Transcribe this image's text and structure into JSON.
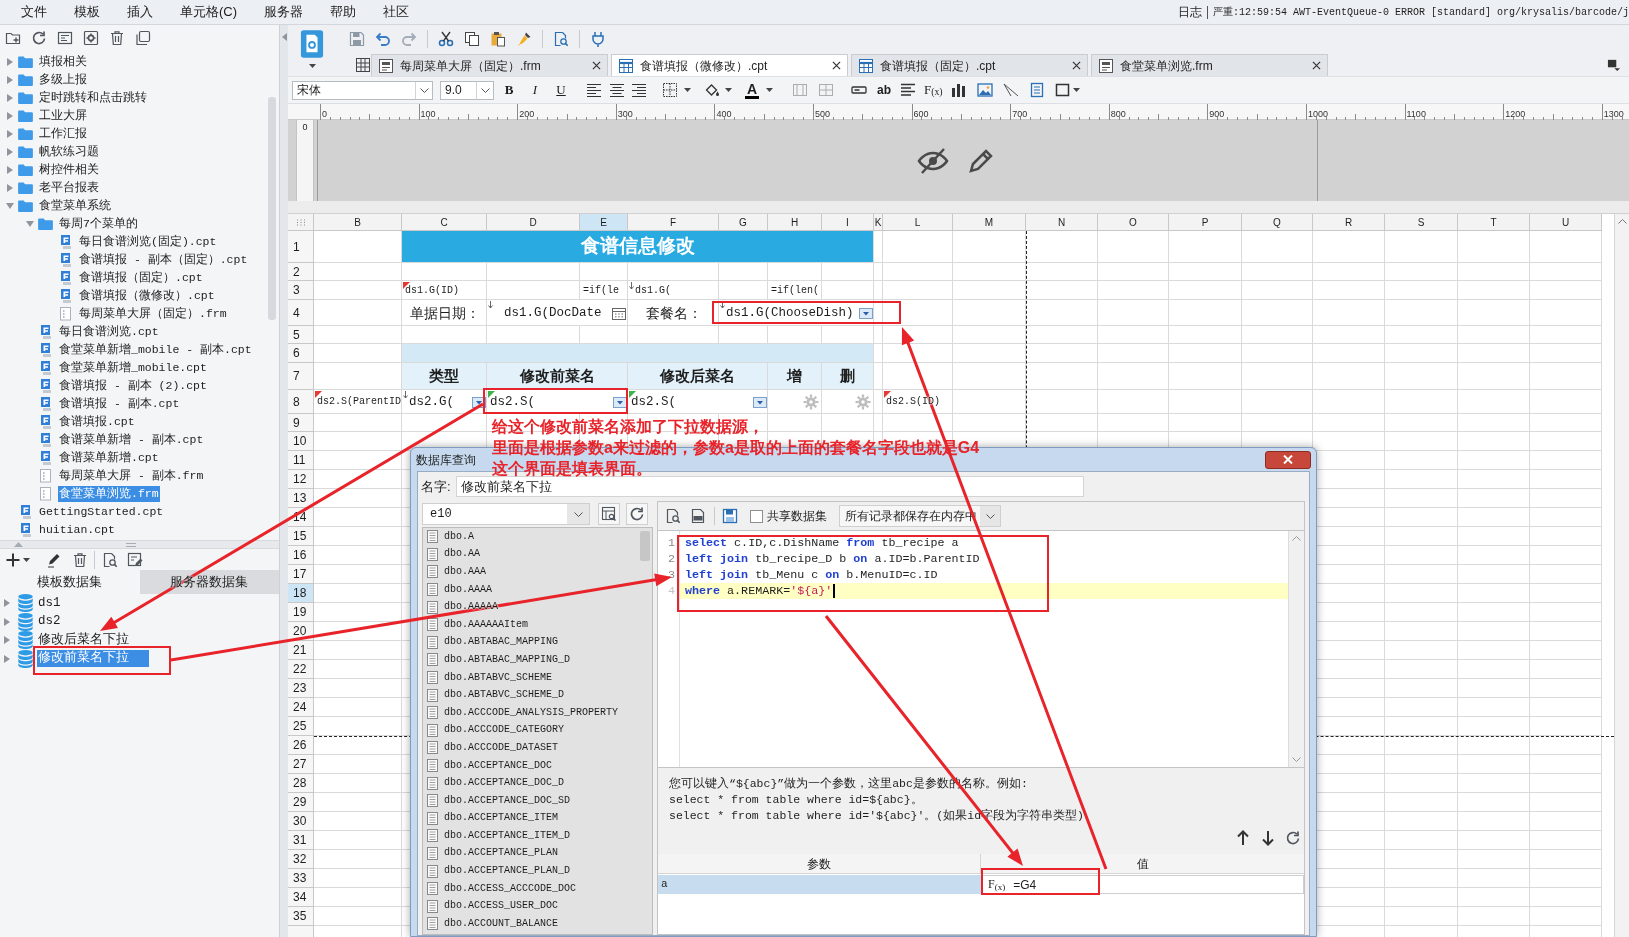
{
  "menu_bar": {
    "items": [
      "文件",
      "模板",
      "插入",
      "单元格(C)",
      "服务器",
      "帮助",
      "社区"
    ],
    "log_label": "日志",
    "log_message": "严重:12:59:54 AWT-EventQueue-0 ERROR [standard] org/krysalis/barcode/j"
  },
  "file_tree": [
    {
      "label": "填报相关",
      "kind": "folder",
      "expanded": false,
      "selected": false
    },
    {
      "label": "多级上报",
      "kind": "folder",
      "expanded": false,
      "selected": false
    },
    {
      "label": "定时跳转和点击跳转",
      "kind": "folder",
      "expanded": false,
      "selected": false
    },
    {
      "label": "工业大屏",
      "kind": "folder",
      "expanded": false,
      "selected": false
    },
    {
      "label": "工作汇报",
      "kind": "folder",
      "expanded": false,
      "selected": false
    },
    {
      "label": "帆软练习题",
      "kind": "folder",
      "expanded": false,
      "selected": false
    },
    {
      "label": "树控件相关",
      "kind": "folder",
      "expanded": false,
      "selected": false
    },
    {
      "label": "老平台报表",
      "kind": "folder",
      "expanded": false,
      "selected": false
    },
    {
      "label": "食堂菜单系统",
      "kind": "folder",
      "expanded": true,
      "selected": false,
      "children": [
        {
          "label": "每周7个菜单的",
          "kind": "folder",
          "expanded": true,
          "selected": false,
          "children": [
            {
              "label": "每日食谱浏览(固定).cpt",
              "kind": "cpt",
              "selected": false
            },
            {
              "label": "食谱填报 - 副本（固定）.cpt",
              "kind": "cpt",
              "selected": false
            },
            {
              "label": "食谱填报（固定）.cpt",
              "kind": "cpt",
              "selected": false
            },
            {
              "label": "食谱填报（微修改）.cpt",
              "kind": "cpt",
              "selected": false
            },
            {
              "label": "每周菜单大屏（固定）.frm",
              "kind": "frm",
              "selected": false
            }
          ]
        },
        {
          "label": "每日食谱浏览.cpt",
          "kind": "cpt",
          "selected": false
        },
        {
          "label": "食堂菜单新增_mobile - 副本.cpt",
          "kind": "cpt",
          "selected": false
        },
        {
          "label": "食堂菜单新增_mobile.cpt",
          "kind": "cpt",
          "selected": false
        },
        {
          "label": "食谱填报 - 副本 (2).cpt",
          "kind": "cpt",
          "selected": false
        },
        {
          "label": "食谱填报 - 副本.cpt",
          "kind": "cpt",
          "selected": false
        },
        {
          "label": "食谱填报.cpt",
          "kind": "cpt",
          "selected": false
        },
        {
          "label": "食谱菜单新增 - 副本.cpt",
          "kind": "cpt",
          "selected": false
        },
        {
          "label": "食谱菜单新增.cpt",
          "kind": "cpt",
          "selected": false
        },
        {
          "label": "每周菜单大屏 - 副本.frm",
          "kind": "frm",
          "selected": false
        },
        {
          "label": "食堂菜单浏览.frm",
          "kind": "frm",
          "selected": true
        }
      ]
    },
    {
      "label": "GettingStarted.cpt",
      "kind": "cpt",
      "selected": false
    },
    {
      "label": "huitian.cpt",
      "kind": "cpt",
      "selected": false
    }
  ],
  "dataset_panel": {
    "tabs": [
      {
        "label": "模板数据集",
        "selected": true
      },
      {
        "label": "服务器数据集",
        "selected": false
      }
    ],
    "datasets": [
      {
        "name": "ds1",
        "expanded": false,
        "selected": false
      },
      {
        "name": "ds2",
        "expanded": false,
        "selected": false
      },
      {
        "name": "修改后菜名下拉",
        "expanded": false,
        "selected": false
      },
      {
        "name": "修改前菜名下拉",
        "expanded": false,
        "selected": true
      }
    ]
  },
  "editor_tabs": [
    {
      "label": "每周菜单大屏（固定）.frm",
      "kind": "frm",
      "selected": false
    },
    {
      "label": "食谱填报（微修改）.cpt",
      "kind": "cpt",
      "selected": true
    },
    {
      "label": "食谱填报（固定）.cpt",
      "kind": "cpt",
      "selected": false
    },
    {
      "label": "食堂菜单浏览.frm",
      "kind": "frm",
      "selected": false
    }
  ],
  "format_toolbar": {
    "font": "宋体",
    "size": "9.0",
    "style_buttons": [
      "B",
      "I",
      "U"
    ],
    "font_color_label": "A",
    "text_tool_label": "ab",
    "formula_tool_label": "F$_{(x)}$"
  },
  "ruler": {
    "labels": [
      "0",
      "100",
      "200",
      "300",
      "400",
      "500",
      "600",
      "700",
      "800",
      "900",
      "1000",
      "1100",
      "1200",
      "1300"
    ],
    "side_label": "0"
  },
  "sheet": {
    "columns": [
      {
        "label": "B",
        "selected": false
      },
      {
        "label": "C",
        "selected": false
      },
      {
        "label": "D",
        "selected": false
      },
      {
        "label": "E",
        "selected": true
      },
      {
        "label": "F",
        "selected": false
      },
      {
        "label": "G",
        "selected": false
      },
      {
        "label": "H",
        "selected": false
      },
      {
        "label": "I",
        "selected": false
      },
      {
        "label": "K",
        "selected": false
      },
      {
        "label": "L",
        "selected": false
      },
      {
        "label": "M",
        "selected": false
      },
      {
        "label": "N",
        "selected": false
      },
      {
        "label": "O",
        "selected": false
      },
      {
        "label": "P",
        "selected": false
      },
      {
        "label": "Q",
        "selected": false
      },
      {
        "label": "R",
        "selected": false
      },
      {
        "label": "S",
        "selected": false
      },
      {
        "label": "T",
        "selected": false
      },
      {
        "label": "U",
        "selected": false
      }
    ],
    "rows": [
      {
        "label": "1",
        "selected": false
      },
      {
        "label": "2",
        "selected": false
      },
      {
        "label": "3",
        "selected": false
      },
      {
        "label": "4",
        "selected": false
      },
      {
        "label": "5",
        "selected": false
      },
      {
        "label": "6",
        "selected": false
      },
      {
        "label": "7",
        "selected": false
      },
      {
        "label": "8",
        "selected": false
      },
      {
        "label": "9",
        "selected": false
      },
      {
        "label": "10",
        "selected": false
      },
      {
        "label": "11",
        "selected": false
      },
      {
        "label": "12",
        "selected": false
      },
      {
        "label": "13",
        "selected": false
      },
      {
        "label": "14",
        "selected": false
      },
      {
        "label": "15",
        "selected": false
      },
      {
        "label": "16",
        "selected": false
      },
      {
        "label": "17",
        "selected": false
      },
      {
        "label": "18",
        "selected": true
      },
      {
        "label": "19",
        "selected": false
      },
      {
        "label": "20",
        "selected": false
      },
      {
        "label": "21",
        "selected": false
      },
      {
        "label": "22",
        "selected": false
      },
      {
        "label": "23",
        "selected": false
      },
      {
        "label": "24",
        "selected": false
      },
      {
        "label": "25",
        "selected": false
      },
      {
        "label": "26",
        "selected": false
      },
      {
        "label": "27",
        "selected": false
      },
      {
        "label": "28",
        "selected": false
      },
      {
        "label": "29",
        "selected": false
      },
      {
        "label": "30",
        "selected": false
      },
      {
        "label": "31",
        "selected": false
      },
      {
        "label": "32",
        "selected": false
      },
      {
        "label": "33",
        "selected": false
      },
      {
        "label": "34",
        "selected": false
      },
      {
        "label": "35",
        "selected": false
      }
    ],
    "cells": {
      "C1:I1": {
        "kind": "title",
        "text": "食谱信息修改"
      },
      "C3": {
        "kind": "formula",
        "text": "ds1.G(ID)",
        "color": "#e53935",
        "expands_down": false
      },
      "E3": {
        "kind": "formula",
        "text": "=if(le",
        "expands_down": false
      },
      "F3": {
        "kind": "formula",
        "text": "ds1.G(",
        "expands_down": true
      },
      "H3": {
        "kind": "formula",
        "text": "=if(len(",
        "expands_down": false
      },
      "C4": {
        "kind": "label",
        "text": "单据日期：",
        "expands_down": false
      },
      "D4:E4": {
        "kind": "date",
        "text": "ds1.G(DocDate",
        "expands_down": true
      },
      "F4": {
        "kind": "label",
        "text": "套餐名：",
        "expands_down": false
      },
      "G4:I4": {
        "kind": "dropdown",
        "text": "ds1.G(ChooseDish)",
        "expands_down": true
      },
      "C6:I6": {
        "kind": "band"
      },
      "C7": {
        "kind": "header",
        "text": "类型"
      },
      "D7:E7": {
        "kind": "header",
        "text": "修改前菜名"
      },
      "F7:G7": {
        "kind": "header",
        "text": "修改后菜名"
      },
      "H7": {
        "kind": "header",
        "text": "增"
      },
      "I7": {
        "kind": "header",
        "text": "删"
      },
      "B8": {
        "kind": "formula",
        "text": "ds2.S(ParentID",
        "color": "#e53935",
        "expands_down": false
      },
      "C8": {
        "kind": "dropdown",
        "text": "ds2.G(",
        "expands_down": true
      },
      "D8:E8": {
        "kind": "dropdown",
        "text": "ds2.S(",
        "color": "#3bb54a",
        "expands_down": false
      },
      "F8:G8": {
        "kind": "dropdown",
        "text": "ds2.S(",
        "color": "#3bb54a",
        "expands_down": false
      },
      "H8": {
        "kind": "button"
      },
      "I8": {
        "kind": "button"
      },
      "L8": {
        "kind": "formula",
        "text": "ds2.S(ID)",
        "color": "#e53935",
        "expands_down": false
      }
    }
  },
  "annotation": {
    "lines": [
      "给这个修改前菜名添加了下拉数据源，",
      "里面是根据参数a来过滤的，参数a是取的上面的套餐名字段也就是G4",
      "这个界面是填表界面。"
    ]
  },
  "query_dialog": {
    "title": "数据库查询",
    "name_label": "名字:",
    "name_value": "修改前菜名下拉",
    "connection": "e10",
    "tables": [
      "dbo.A",
      "dbo.AA",
      "dbo.AAA",
      "dbo.AAAA",
      "dbo.AAAAA",
      "dbo.AAAAAAItem",
      "dbo.ABTABAC_MAPPING",
      "dbo.ABTABAC_MAPPING_D",
      "dbo.ABTABVC_SCHEME",
      "dbo.ABTABVC_SCHEME_D",
      "dbo.ACCCODE_ANALYSIS_PROPERTY",
      "dbo.ACCCODE_CATEGORY",
      "dbo.ACCCODE_DATASET",
      "dbo.ACCEPTANCE_DOC",
      "dbo.ACCEPTANCE_DOC_D",
      "dbo.ACCEPTANCE_DOC_SD",
      "dbo.ACCEPTANCE_ITEM",
      "dbo.ACCEPTANCE_ITEM_D",
      "dbo.ACCEPTANCE_PLAN",
      "dbo.ACCEPTANCE_PLAN_D",
      "dbo.ACCESS_ACCCODE_DOC",
      "dbo.ACCESS_USER_DOC",
      "dbo.ACCOUNT_BALANCE"
    ],
    "share_dataset": {
      "label": "共享数据集",
      "checked": false
    },
    "storage_mode": "所有记录都保存在内存中",
    "sql": [
      {
        "number": "1",
        "current": false,
        "tokens": [
          {
            "kind": "keyword",
            "text": "select"
          },
          {
            "kind": "plain",
            "text": " c.ID,c.DishName "
          },
          {
            "kind": "keyword",
            "text": "from"
          },
          {
            "kind": "plain",
            "text": " tb_recipe a"
          }
        ]
      },
      {
        "number": "2",
        "current": false,
        "tokens": [
          {
            "kind": "keyword",
            "text": "left join"
          },
          {
            "kind": "plain",
            "text": " tb_recipe_D b "
          },
          {
            "kind": "keyword",
            "text": "on"
          },
          {
            "kind": "plain",
            "text": " a.ID=b.ParentID"
          }
        ]
      },
      {
        "number": "3",
        "current": false,
        "tokens": [
          {
            "kind": "keyword",
            "text": "left join"
          },
          {
            "kind": "plain",
            "text": " tb_Menu c "
          },
          {
            "kind": "keyword",
            "text": "on"
          },
          {
            "kind": "plain",
            "text": " b.MenuID=c.ID"
          }
        ]
      },
      {
        "number": "4",
        "current": true,
        "tokens": [
          {
            "kind": "keyword",
            "text": "where"
          },
          {
            "kind": "plain",
            "text": " a.REMARK="
          },
          {
            "kind": "string",
            "text": "'${a}'"
          }
        ]
      }
    ],
    "help": [
      "您可以键入“${abc}”做为一个参数，这里abc是参数的名称。例如:",
      "select * from table where id=${abc}。",
      "select * from table where id='${abc}'。(如果id字段为字符串类型)"
    ],
    "parameters": {
      "columns": [
        "参数",
        "值"
      ],
      "rows": [
        {
          "name": "a",
          "formula_glyph": "F$_{(x)}$",
          "value": "=G4",
          "selected": true
        }
      ]
    }
  }
}
